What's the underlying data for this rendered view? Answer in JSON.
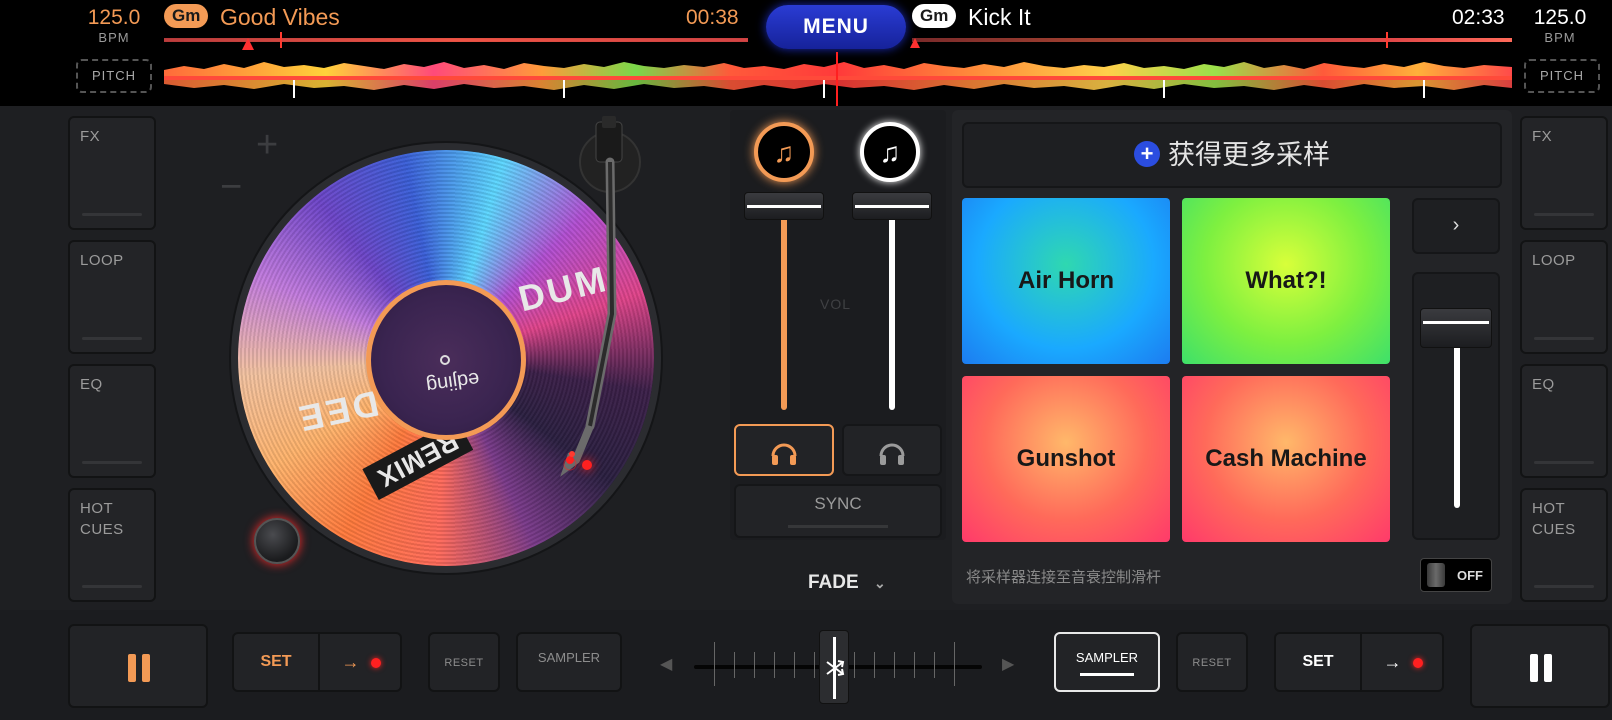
{
  "colors": {
    "deck_a": "#f39a55",
    "deck_b": "#ffffff",
    "menu": "#1f31c0",
    "accent_blue": "#2b4de0"
  },
  "deck_a": {
    "bpm": "125.0",
    "bpm_label": "BPM",
    "pitch_label": "PITCH",
    "key": "Gm",
    "title": "Good Vibes",
    "time": "00:38"
  },
  "deck_b": {
    "bpm": "125.0",
    "bpm_label": "BPM",
    "pitch_label": "PITCH",
    "key": "Gm",
    "title": "Kick It",
    "time": "02:33"
  },
  "menu_label": "MENU",
  "left_side": [
    "FX",
    "LOOP",
    "EQ",
    "HOT\nCUES"
  ],
  "right_side": [
    "FX",
    "LOOP",
    "EQ",
    "HOT\nCUES"
  ],
  "turntable": {
    "plus": "+",
    "minus": "−",
    "label_texts": {
      "dum": "DUM",
      "dee": "DEE",
      "remix": "REMIX",
      "edjing": "edjing"
    }
  },
  "mixer": {
    "deck_a_icon": "music-note-icon",
    "deck_b_icon": "music-note-icon",
    "vol_label": "VOL",
    "deck_a_volume": 1.0,
    "deck_b_volume": 1.0,
    "sync_label": "SYNC",
    "fade_label": "FADE"
  },
  "sampler": {
    "more_samples": "获得更多采样",
    "pads": [
      {
        "label": "Air Horn"
      },
      {
        "label": "What?!"
      },
      {
        "label": "Gunshot"
      },
      {
        "label": "Cash Machine"
      }
    ],
    "next_label": "›",
    "hint": "将采样器连接至音衰控制滑杆",
    "toggle_label": "OFF",
    "volume": 1.0
  },
  "bottom": {
    "set_label": "SET",
    "reset_label": "RESET",
    "sampler_label": "SAMPLER",
    "crossfader_position": 0.5
  }
}
